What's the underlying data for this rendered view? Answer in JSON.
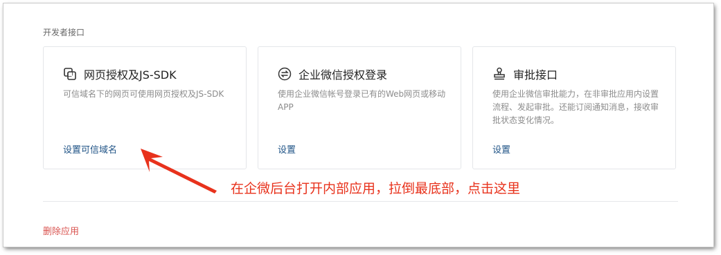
{
  "section": {
    "title": "开发者接口"
  },
  "cards": [
    {
      "icon": "link-icon",
      "title": "网页授权及JS-SDK",
      "desc": "可信域名下的网页可使用网页授权及JS-SDK",
      "link": "设置可信域名"
    },
    {
      "icon": "swap-arrows-icon",
      "title": "企业微信授权登录",
      "desc": "使用企业微信帐号登录已有的Web网页或移动APP",
      "link": "设置"
    },
    {
      "icon": "stamp-icon",
      "title": "审批接口",
      "desc": "使用企业微信审批能力，在非审批应用内设置流程、发起审批。还能订阅通知消息，接收审批状态变化情况。",
      "link": "设置"
    }
  ],
  "delete_app": "删除应用",
  "annotation": {
    "text": "在企微后台打开内部应用，拉倒最底部，点击这里",
    "color": "#e8321c"
  },
  "colors": {
    "link": "#1f5386",
    "danger": "#d9534f",
    "border": "#e4e6e9"
  }
}
